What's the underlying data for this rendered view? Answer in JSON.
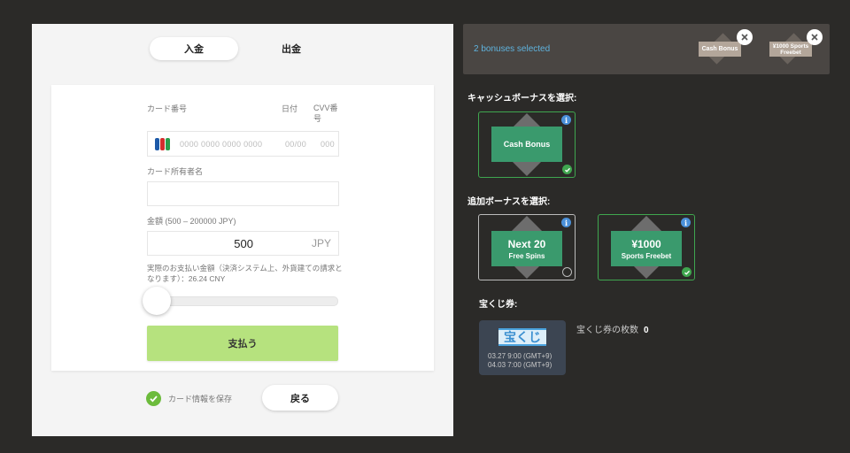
{
  "tabs": {
    "deposit": "入金",
    "withdraw": "出金"
  },
  "form": {
    "card_number_label": "カード番号",
    "date_label": "日付",
    "cvv_label": "CVV番号",
    "card_number_placeholder": "0000 0000 0000 0000",
    "date_placeholder": "00/00",
    "cvv_placeholder": "000",
    "card_brand": "JCB",
    "holder_label": "カード所有者名",
    "holder_value": "",
    "amount_label": "金額 (500 – 200000 JPY)",
    "amount_value": "500",
    "amount_currency": "JPY",
    "note": "実際のお支払い金額（決済システム上、外貨建ての請求となります）：26.24 CNY",
    "slider_fraction": 0,
    "pay_button": "支払う",
    "save_card_label": "カード情報を保存",
    "back_button": "戻る"
  },
  "selected": {
    "text": "2 bonuses selected",
    "items": [
      {
        "label": "Cash Bonus"
      },
      {
        "label": "¥1000 Sports Freebet"
      }
    ]
  },
  "cash_section": {
    "title": "キャッシュボーナスを選択:",
    "bonuses": [
      {
        "line1": "Cash Bonus",
        "line2": "",
        "selected": true
      }
    ]
  },
  "extra_section": {
    "title": "追加ボーナスを選択:",
    "bonuses": [
      {
        "line1": "Next 20",
        "line2": "Free Spins",
        "selected": false
      },
      {
        "line1": "¥1000",
        "line2": "Sports Freebet",
        "selected": true
      }
    ]
  },
  "lottery": {
    "title": "宝くじ券:",
    "card_title": "宝くじ",
    "date1": "03.27 9:00 (GMT+9)",
    "date2": "04.03 7:00 (GMT+9)",
    "count_label": "宝くじ券の枚数",
    "count_value": "0"
  },
  "colors": {
    "background": "#2b2a28",
    "pay_button": "#b6e27e",
    "bonus_plate": "#3a9a6d",
    "selected_border": "#3fa64f",
    "link_blue": "#5fb3de",
    "info_blue": "#4a90d9"
  }
}
